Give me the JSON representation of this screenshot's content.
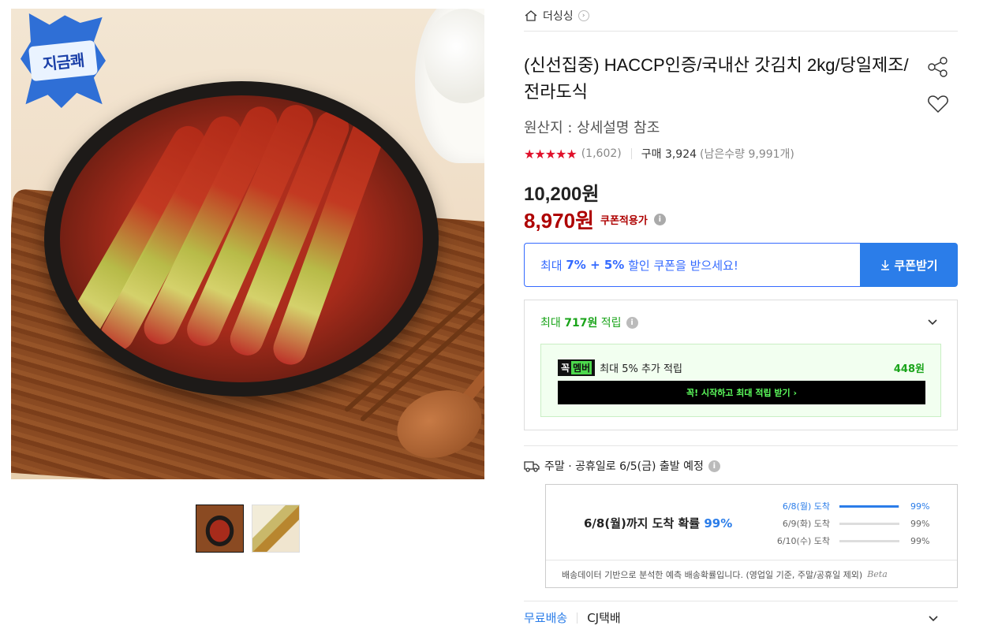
{
  "gallery": {
    "badge_text": "지금쾌",
    "thumbnails": [
      "product-main-thumbnail",
      "product-detail-thumbnail"
    ]
  },
  "header": {
    "brand": "더싱싱"
  },
  "product": {
    "title": "(신선집중) HACCP인증/국내산 갓김치 2kg/당일제조/전라도식",
    "origin": "원산지 : 상세설명 참조",
    "rating_stars": "★★★★★",
    "rating": 4.5,
    "review_count": "(1,602)",
    "purchase": "구매 3,924",
    "remaining": "(남은수량 9,991개)"
  },
  "price": {
    "original": "10,200원",
    "sale": "8,970원",
    "coupon_applied": "쿠폰적용가"
  },
  "coupon": {
    "text_prefix": "최대 ",
    "text_bold": "7% + 5%",
    "text_suffix": " 할인 쿠폰을 받으세요!",
    "button_label": "쿠폰받기"
  },
  "reward": {
    "head_prefix": "최대 ",
    "head_amount": "717원",
    "head_suffix": " 적립",
    "wow_logo_left": "꼭",
    "wow_logo_right": "멤버",
    "wow_text": "최대 5% 추가 적립",
    "wow_amount": "448원",
    "wow_button": "꼭! 시작하고 최대 적립 받기 ›"
  },
  "shipping": {
    "schedule": "주말 · 공휴일로 6/5(금) 출발 예정",
    "probability_main_prefix": "6/8(월)까지 도착 확률 ",
    "probability_main_pct": "99%",
    "probabilities": [
      {
        "label": "6/8(월) 도착",
        "value": "99%",
        "fraction": 0.99
      },
      {
        "label": "6/9(화) 도착",
        "value": "99%",
        "fraction": 0.99
      },
      {
        "label": "6/10(수) 도착",
        "value": "99%",
        "fraction": 0.99
      }
    ],
    "footnote": "배송데이터 기반으로 분석한 예측 배송확률입니다. (영업일 기준, 주말/공휴일 제외)",
    "beta_label": "Beta"
  },
  "delivery": {
    "free": "무료배송",
    "carrier": "CJ택배"
  },
  "colors": {
    "accent_blue": "#2b7de9",
    "sale_red": "#ae0000",
    "reward_green": "#1aa41a",
    "star_red": "#e0102a"
  }
}
